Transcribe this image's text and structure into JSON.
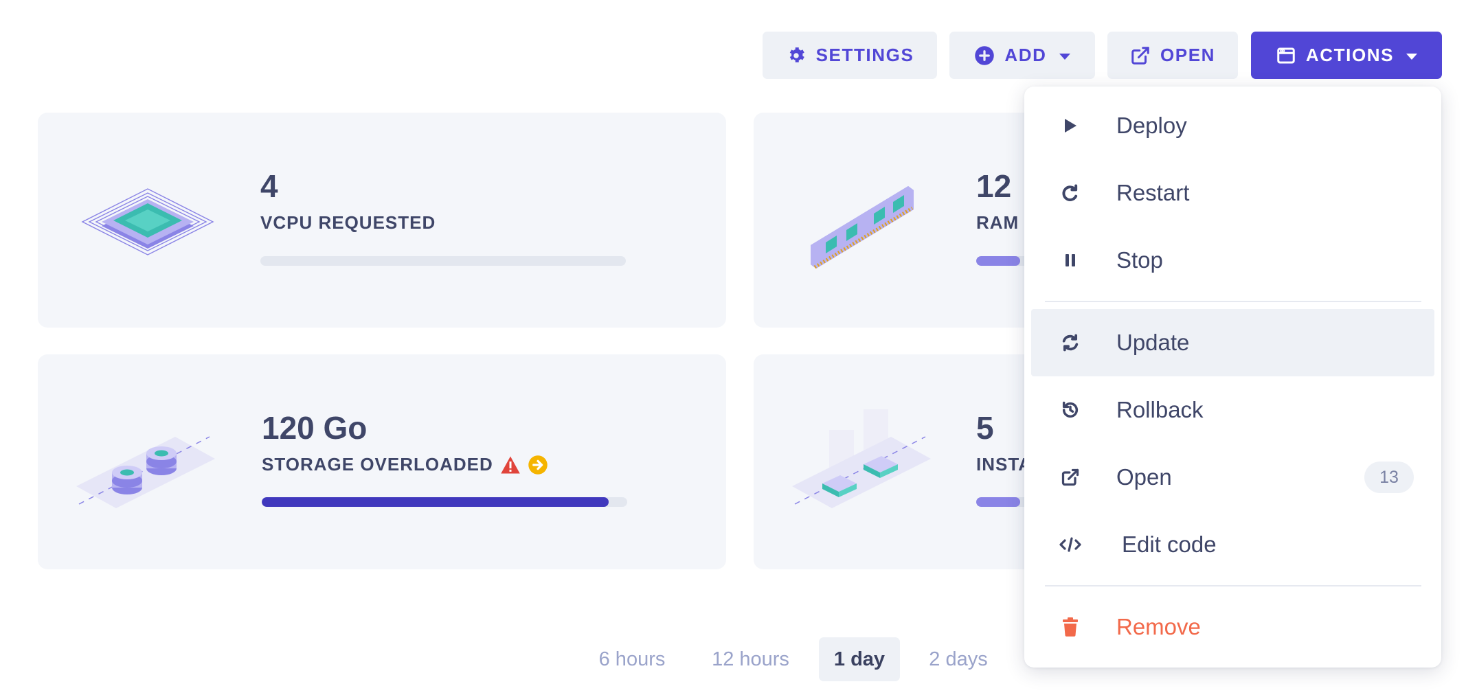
{
  "toolbar": {
    "settings_label": "SETTINGS",
    "add_label": "ADD",
    "open_label": "OPEN",
    "actions_label": "ACTIONS"
  },
  "cards": [
    {
      "value": "4",
      "label": "VCPU REQUESTED",
      "progress": 0.0,
      "illustration": "cpu-chip"
    },
    {
      "value": "12",
      "label": "RAM",
      "progress": 0.12,
      "illustration": "ram-module"
    },
    {
      "value": "120 Go",
      "label": "STORAGE OVERLOADED",
      "progress": 0.95,
      "illustration": "storage-disks",
      "warning_icon": "warning-triangle-icon",
      "info_icon": "arrow-circle-icon"
    },
    {
      "value": "5",
      "label": "INSTA",
      "progress": 0.12,
      "illustration": "instances-boxes"
    }
  ],
  "time_range": {
    "options": [
      "6 hours",
      "12 hours",
      "1 day",
      "2 days"
    ],
    "selected": "1 day"
  },
  "actions_menu": {
    "items": [
      {
        "label": "Deploy",
        "icon": "play-icon"
      },
      {
        "label": "Restart",
        "icon": "restart-icon"
      },
      {
        "label": "Stop",
        "icon": "pause-icon"
      },
      {
        "label": "Update",
        "icon": "sync-icon",
        "highlighted": true
      },
      {
        "label": "Rollback",
        "icon": "history-icon"
      },
      {
        "label": "Open",
        "icon": "external-link-icon",
        "badge": "13"
      },
      {
        "label": "Edit code",
        "icon": "code-icon"
      },
      {
        "label": "Remove",
        "icon": "trash-icon",
        "danger": true
      }
    ]
  },
  "colors": {
    "accent": "#5146d6",
    "bar_dark": "#4038bd",
    "bar_light": "#8a84e6",
    "danger": "#f2694a",
    "warning_red": "#e0443b",
    "warning_yellow": "#f5b400"
  }
}
